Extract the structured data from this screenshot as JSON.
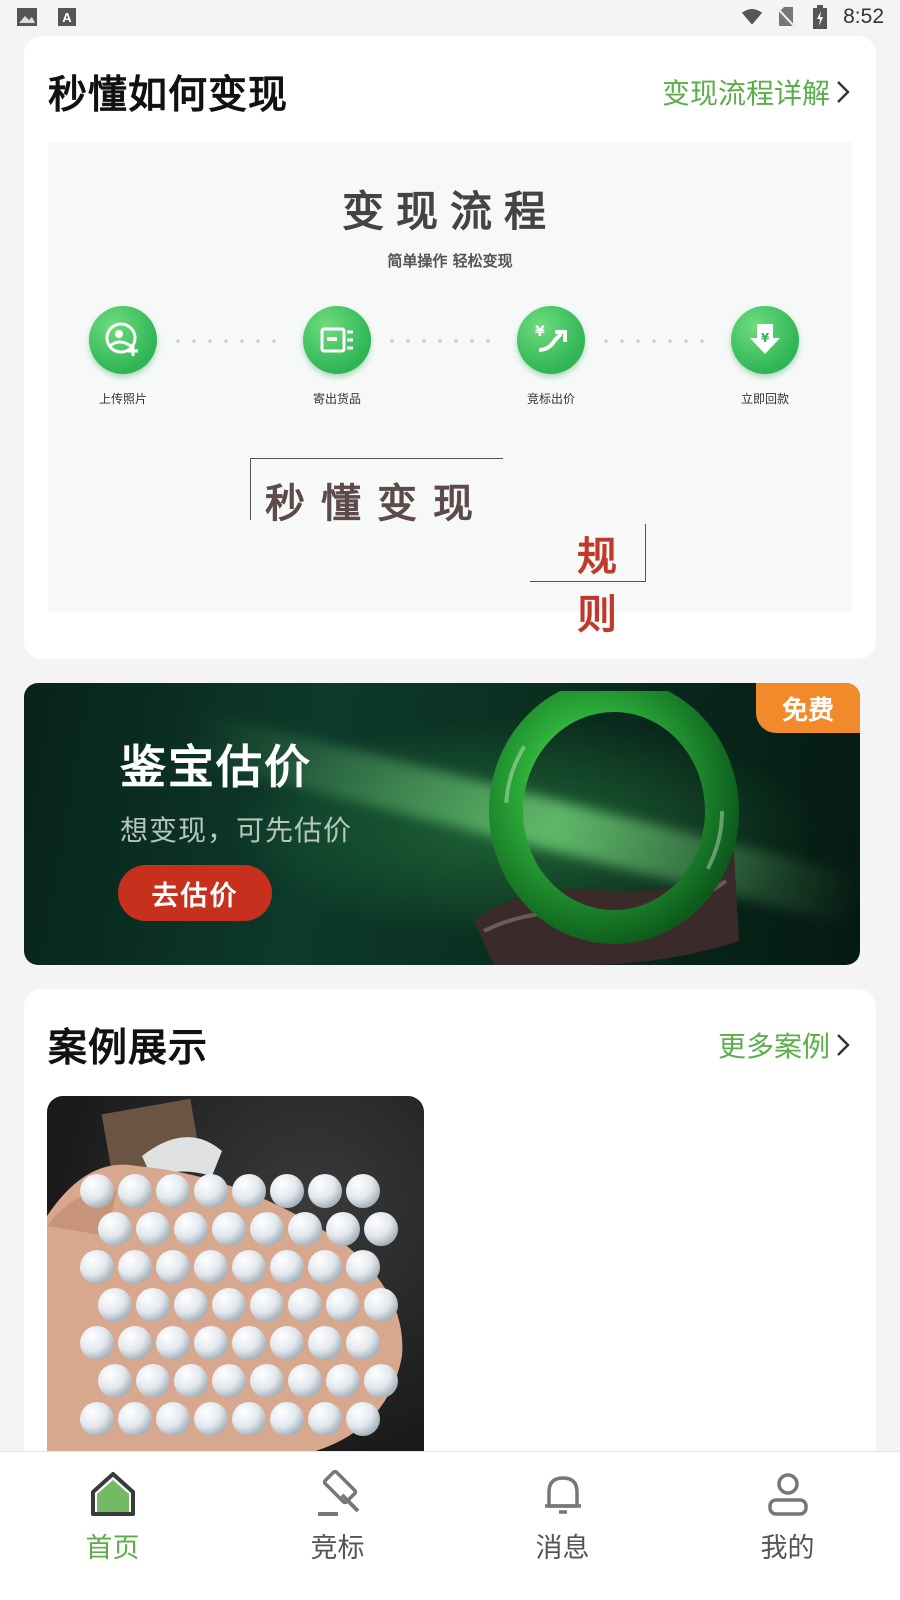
{
  "status_bar": {
    "time": "8:52",
    "icons": [
      "image-icon",
      "a-icon",
      "wifi-icon",
      "no-sim-icon",
      "battery-icon"
    ]
  },
  "how_card": {
    "title": "秒懂如何变现",
    "link": "变现流程详解",
    "process": {
      "title": "变现流程",
      "subtitle": "简单操作 轻松变现",
      "steps": [
        {
          "label": "上传照片",
          "icon": "upload-photo-icon"
        },
        {
          "label": "寄出货品",
          "icon": "ship-goods-icon"
        },
        {
          "label": "竞标出价",
          "icon": "bid-price-icon"
        },
        {
          "label": "立即回款",
          "icon": "payment-icon"
        }
      ],
      "slogan_line1": "秒懂变现",
      "slogan_line2": "规则"
    }
  },
  "banner": {
    "title": "鉴宝估价",
    "subtitle": "想变现，可先估价",
    "button": "去估价",
    "badge": "免费"
  },
  "case_card": {
    "title": "案例展示",
    "link": "更多案例"
  },
  "tabbar": {
    "tabs": [
      {
        "label": "首页",
        "icon": "home-icon",
        "active": true
      },
      {
        "label": "竞标",
        "icon": "gavel-icon",
        "active": false
      },
      {
        "label": "消息",
        "icon": "bell-icon",
        "active": false
      },
      {
        "label": "我的",
        "icon": "user-icon",
        "active": false
      }
    ]
  },
  "colors": {
    "accent": "#5cae4a",
    "button_red": "#c8301e",
    "badge_orange": "#f2892b"
  }
}
